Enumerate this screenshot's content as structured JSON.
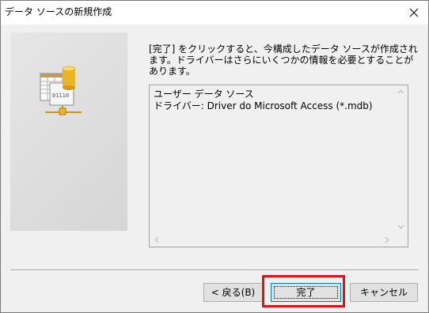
{
  "window": {
    "title": "データ ソースの新規作成"
  },
  "instruction": {
    "text": "[完了] をクリックすると、今構成したデータ ソースが作成されます。ドライバーはさらにいくつかの情報を必要とすることがあります。"
  },
  "info_box": {
    "lines": [
      "ユーザー データ ソース",
      "ドライバー:  Driver do Microsoft Access (*.mdb)"
    ]
  },
  "buttons": {
    "back": "< 戻る(B)",
    "finish": "完了",
    "cancel": "キャンセル"
  },
  "icons": {
    "close": "close-icon",
    "wizard": "database-network-icon"
  },
  "colors": {
    "highlight": "#d9141b",
    "default_button_border": "#0078d7"
  }
}
